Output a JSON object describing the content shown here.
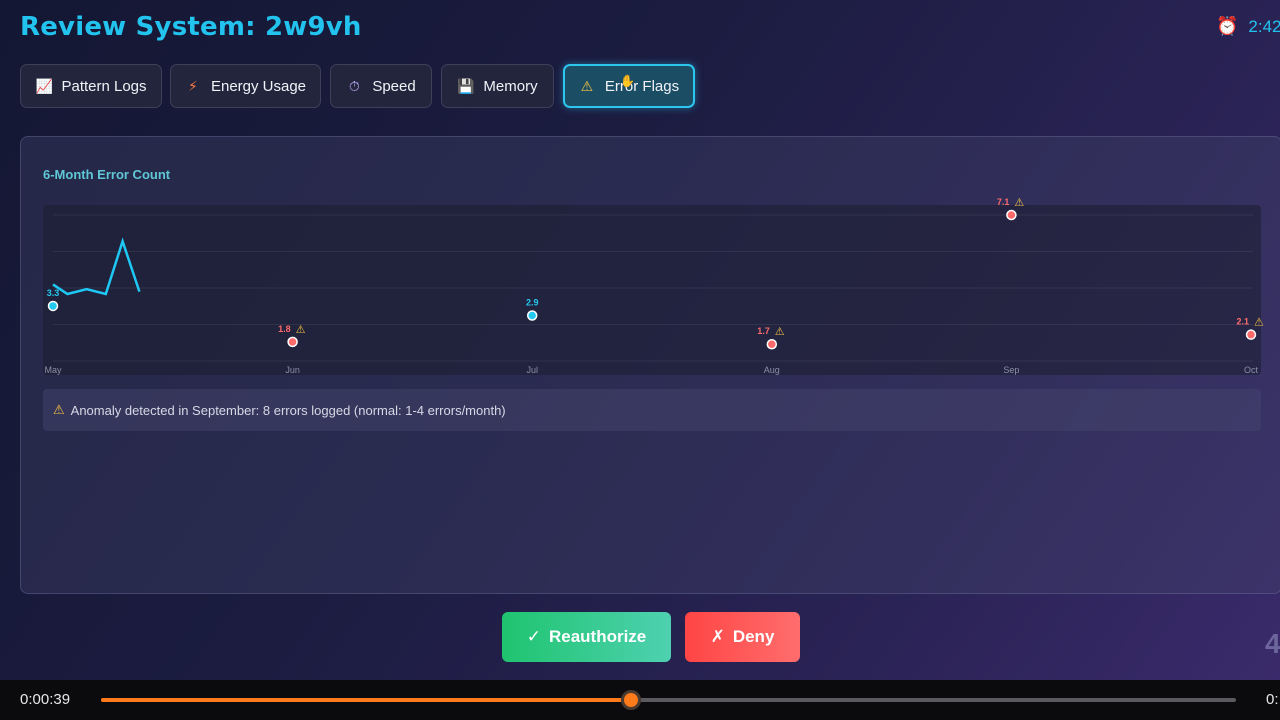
{
  "header": {
    "title": "Review System: 2w9vh",
    "timer_icon": "alarm-clock-icon",
    "timer_text": "2:42"
  },
  "tabs": [
    {
      "label": "Pattern Logs",
      "icon": "chart-icon",
      "active": false
    },
    {
      "label": "Energy Usage",
      "icon": "bolt-icon",
      "active": false
    },
    {
      "label": "Speed",
      "icon": "stopwatch-icon",
      "active": false
    },
    {
      "label": "Memory",
      "icon": "floppy-disk-icon",
      "active": false
    },
    {
      "label": "Error Flags",
      "icon": "warning-icon",
      "active": true
    }
  ],
  "panel": {
    "chart_title": "6-Month Error Count",
    "anomaly_text": "Anomaly detected in September: 8 errors logged (normal: 1-4 errors/month)"
  },
  "chart_data": {
    "type": "scatter",
    "title": "6-Month Error Count",
    "categories": [
      "May",
      "Jun",
      "Jul",
      "Aug",
      "Sep",
      "Oct"
    ],
    "points": [
      {
        "x": "May",
        "y": 3.3,
        "label": "3.3",
        "flagged": false
      },
      {
        "x": "Jun",
        "y": 1.8,
        "label": "1.8",
        "flagged": true
      },
      {
        "x": "Jul",
        "y": 2.9,
        "label": "2.9",
        "flagged": false
      },
      {
        "x": "Aug",
        "y": 1.7,
        "label": "1.7",
        "flagged": true
      },
      {
        "x": "Sep",
        "y": 7.1,
        "label": "7.1",
        "flagged": true
      },
      {
        "x": "Oct",
        "y": 2.1,
        "label": "2.1",
        "flagged": true
      }
    ],
    "partial_line": {
      "x_position": [
        0,
        0.06,
        0.14,
        0.22,
        0.29,
        0.36
      ],
      "y": [
        4.2,
        3.8,
        4.0,
        3.8,
        6.0,
        3.9
      ]
    },
    "ylim": [
      1,
      7.1
    ],
    "grid": true,
    "colors": {
      "normal": "#25c8ef",
      "flagged": "#ff6a6a",
      "line": "#1ec8f5",
      "warning": "#f5c242"
    }
  },
  "actions": {
    "approve_label": "Reauthorize",
    "approve_icon": "checkmark-icon",
    "deny_label": "Deny",
    "deny_icon": "x-icon"
  },
  "corner_number": "4",
  "player": {
    "current_time": "0:00:39",
    "end_time": "0:",
    "progress": 0.467
  }
}
